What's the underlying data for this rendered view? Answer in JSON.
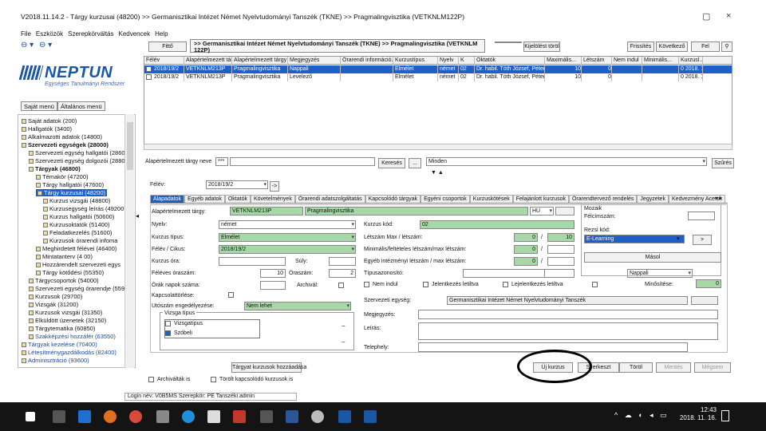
{
  "window": {
    "title": "V2018.11.14.2 - Tárgy kurzusai (48200) >> Germanisztikai Intézet Német Nyelvtudományi Tanszék (TKNE) >> Pragmalingvisztika (VETKNLM122P)",
    "controls": [
      "▢",
      "×"
    ]
  },
  "menu": [
    "File",
    "Eszközök",
    "Szerepkörváltás",
    "Kedvencek",
    "Help"
  ],
  "nav": {
    "back": "⊖ ▾",
    "forward": "⊖ ▾"
  },
  "logo": {
    "brand": "NEPTUN",
    "subtitle": "Egységes Tanulmányi Rendszer"
  },
  "left_tabs": [
    "Saját menü",
    "Általános menü"
  ],
  "tree": [
    {
      "label": "Saját adatok (200)",
      "indent": 0
    },
    {
      "label": "Hallgatók (3400)",
      "indent": 0
    },
    {
      "label": "Alkalmazotti adatok (14800)",
      "indent": 0
    },
    {
      "label": "Szervezeti egységek (28000)",
      "indent": 0,
      "bold": true
    },
    {
      "label": "Szervezeti egység hallgatói (2860",
      "indent": 1
    },
    {
      "label": "Szervezeti egység dolgozói (2880",
      "indent": 1
    },
    {
      "label": "Tárgyak (46800)",
      "indent": 1,
      "bold": true
    },
    {
      "label": "Témakör (47200)",
      "indent": 2
    },
    {
      "label": "Tárgy hallgatói (47600)",
      "indent": 2
    },
    {
      "label": "Tárgy kurzusai (48200)",
      "indent": 2,
      "selected": true
    },
    {
      "label": "Kurzus vizsgái (48800)",
      "indent": 3
    },
    {
      "label": "Kurzusegység leírás (49200",
      "indent": 3
    },
    {
      "label": "Kurzus hallgatói (50600)",
      "indent": 3
    },
    {
      "label": "Kurzusoktatók (51400)",
      "indent": 3
    },
    {
      "label": "Feladatkezelés (51600)",
      "indent": 3
    },
    {
      "label": "Kurzusok órarendi infoma",
      "indent": 3
    },
    {
      "label": "Meghirdetett félévei (46400)",
      "indent": 2
    },
    {
      "label": "Mintatanterv (4 00)",
      "indent": 2
    },
    {
      "label": "Hozzárendelt szervezeti egys",
      "indent": 2
    },
    {
      "label": "Tárgy kötődési (55350)",
      "indent": 2
    },
    {
      "label": "Tárgycsoportok (54000)",
      "indent": 1
    },
    {
      "label": "Szervezeti egység órarendje (5590",
      "indent": 1
    },
    {
      "label": "Kurzusok (29700)",
      "indent": 1
    },
    {
      "label": "Vizsgák (31200)",
      "indent": 1
    },
    {
      "label": "Kurzusok vizsgái (31350)",
      "indent": 1
    },
    {
      "label": "Elküldött üzenetek (32150)",
      "indent": 1
    },
    {
      "label": "Tárgytematika (60850)",
      "indent": 1
    },
    {
      "label": "Szakképzési hozzáfér (63550)",
      "indent": 1,
      "blue": true
    },
    {
      "label": "Tárgyak kezelése (70400)",
      "indent": 0,
      "blue": true
    },
    {
      "label": "Létesítménygazdálkodás (82400)",
      "indent": 0,
      "blue": true
    },
    {
      "label": "Adminisztráció (93600)",
      "indent": 0,
      "blue": true
    }
  ],
  "top_buttons": {
    "filter": "Fittő",
    "kijelolas": "Kijelölés",
    "kijelolest_torol": "Kijelölést töröl",
    "frissites": "Frissítés",
    "kovetkezo": "Következő",
    "fel": "Fel",
    "pin": "⚲"
  },
  "header_title": ">> Germanisztikai Intézet Német Nyelvtudományi Tanszék (TKNE) >> Pragmalingvisztika (VETKNLM 122P)",
  "grid": {
    "columns": [
      "Félév",
      "Alapértelmezett tárgy...",
      "Alapértelmezett tárgy neve",
      "Megjegyzés",
      "Órarendi információ...",
      "Kurzustípus",
      "Nyelv",
      "K",
      "Oktatók",
      "Maximális...",
      "Létszám",
      "Nem indul",
      "Minimális...",
      "Kurzusl..."
    ],
    "rows": [
      [
        "2018/19/2",
        "VETKNLM213P",
        "Pragmalingvisztika",
        "Nappali",
        "",
        "Elmélet",
        "német",
        "02",
        "Dr. habil. Tóth József, Péter",
        "10",
        "0",
        "",
        "",
        "0 2018. 11."
      ],
      [
        "2018/19/2",
        "VETKNLM213P",
        "Pragmalingvisztika",
        "Levelező",
        "",
        "Elmélet",
        "német",
        "02",
        "Dr. habil. Tóth József, Péter",
        "10",
        "0",
        "",
        "",
        "0 2018. 11."
      ]
    ]
  },
  "search": {
    "label": "Alapértelmezett tárgy neve",
    "operator": "***",
    "value": "",
    "button": "Keresés",
    "dots": "...",
    "filter_value": "Minden",
    "szures": "Szűrés"
  },
  "semester": {
    "label": "Félév:",
    "value": "2018/19/2",
    "arrow": "->"
  },
  "tabs": [
    "Alapadatok",
    "Egyéb adatok",
    "Oktatók",
    "Követelmények",
    "Órarendi adatszolgáltatás",
    "Kapcsolódó tárgyak",
    "Egyéni csoportok",
    "Kurzuskötések",
    "Felajánlott kurzusok",
    "Órarendtervező rendelés",
    "Jegyzetek",
    "Kedvezmény Acetok"
  ],
  "form": {
    "alap_targy_label": "Alapértelmezett tárgy:",
    "alap_targy_code": "VETKNLM213P",
    "alap_targy_name": "Pragmalingvisztika",
    "hu": "HU",
    "nyelv_label": "Nyelv:",
    "nyelv": "német",
    "kurzus_tipus_label": "Kurzus típus:",
    "kurzus_tipus": "Elmélet",
    "felev_label": "Félév / Cikus:",
    "felev": "2018/19/2",
    "kurzus_kod_label": "Kurzus kód:",
    "kurzus_kod": "02",
    "oraszam_label": "Kurzus óra:",
    "silly_label": "Súly:",
    "felev_oraszam_label": "Féléves óraszám:",
    "felev_oraszam": "10",
    "oraszam2_label": "Óraszám:",
    "oraszam2": "2",
    "orak_label": "Órák napok száma:",
    "archival_label": "Archivál:",
    "kapcsolatorles_label": "Kapcsolattörlése:",
    "utoszam_label": "Utószám engedélyezése:",
    "utoszam_value": "Nem lehet",
    "vizsga_tipus_label": "Vizsga típus",
    "vizsga_items": [
      "Vizsgatípus",
      "Szóbeli"
    ],
    "letszam_label": "Létszám Max / létszám:",
    "letszam_val1": "0",
    "letszam_val2": "10",
    "minimum_label": "Minimális/feltételes létszám/max létszám:",
    "minimum_val": "0",
    "egyeni_label": "Egyéb intézményi létszám / max létszám:",
    "egyeni_val": "0",
    "tipusazonosito_label": "Típusazonosító:",
    "nem_indul_label": "Nem indul",
    "jelentkezes_label": "Jelentkezés letiltva",
    "lejelentkezes_label": "Lejelentkezés letiltva",
    "szervezeti_label": "Szervezeti egység:",
    "szervezeti_value": "Germanisztikai Intézet Német Nyelvtudományi Tanszék",
    "megjegyzes_label": "Megjegyzés:",
    "leiras_label": "Leírás:",
    "telephely_label": "Telephely:",
    "minosites_label": "Minősítése:",
    "minosites_val": "0",
    "nappali": "Nappali"
  },
  "right_panel": {
    "title": "Mozaik",
    "felcimszam_label": "Félcímszám:",
    "rezsi_label": "Rezsi kód:",
    "kod_label": "Kód:",
    "elearning": "E-Learning",
    "masol": "Másol",
    "arrow": ">"
  },
  "bottom": {
    "targy_hozzaadas": "Tárgyat kurzusok hozzáadása",
    "archivallak": "Archiválták is",
    "torolt": "Törölt kapcsolódó kurzusok is",
    "uj_kurzus": "Új kurzus",
    "szerkeszt": "Szerkeszt",
    "torol": "Töröl",
    "mentes": "Mentés",
    "megsem": "Mégsem"
  },
  "status": "Login név: V0B5MS  Szerepkör: PE Tanszéki admin",
  "taskbar": {
    "time": "12:43",
    "date": "2018. 11. 16.",
    "tray": "^ ☁ ◐ ◂ ▭"
  }
}
